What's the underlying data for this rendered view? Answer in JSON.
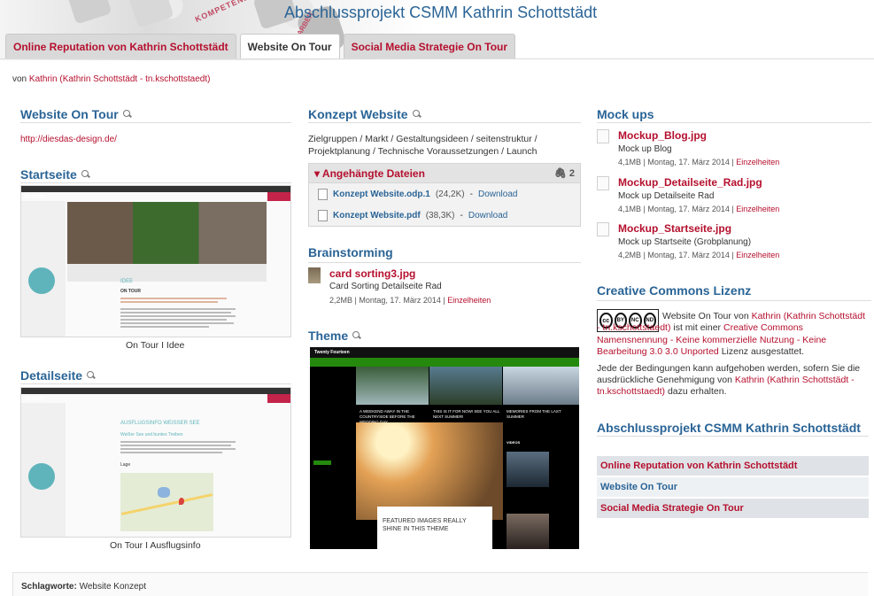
{
  "header": {
    "site_title": "Abschlussprojekt CSMM Kathrin Schottstädt",
    "logo_word_1": "KOMPETENZ",
    "logo_word_2": "ARBEIT",
    "tabs": [
      {
        "label": "Online Reputation von Kathrin Schottstädt",
        "active": false
      },
      {
        "label": "Website On Tour",
        "active": true
      },
      {
        "label": "Social Media Strategie On Tour",
        "active": false
      }
    ]
  },
  "byline": {
    "prefix": "von",
    "author": "Kathrin (Kathrin Schottstädt - tn.kschottstaedt)"
  },
  "col1": {
    "website_title": "Website On Tour",
    "website_link": "http://diesdas-design.de/",
    "start_title": "Startseite",
    "start_caption": "On Tour I Idee",
    "start_shot": {
      "site_name": "ON TOUR",
      "heading": "IDEE",
      "subheading": "ON TOUR"
    },
    "detail_title": "Detailseite",
    "detail_caption": "On Tour I Ausflugsinfo",
    "detail_shot": {
      "site_name": "ON TOUR",
      "heading": "AUSFLUGSINFO WEISSER SEE",
      "subheading": "Weißer See und buntes Treiben",
      "map_label": "Lage"
    }
  },
  "col2": {
    "concept_title": "Konzept Website",
    "concept_text": "Zielgruppen / Markt / Gestaltungsideen / seitenstruktur / Projektplanung / Technische Voraussetzungen / Launch",
    "attachments_label": "Angehängte Dateien",
    "attachments_count": "2",
    "files": [
      {
        "name": "Konzept Website.odp.1",
        "size": "(24,2K)",
        "sep": "-",
        "download": "Download"
      },
      {
        "name": "Konzept Website.pdf",
        "size": "(38,3K)",
        "sep": "-",
        "download": "Download"
      }
    ],
    "brainstorm_title": "Brainstorming",
    "brainstorm_file": "card sorting3.jpg",
    "brainstorm_desc": "Card Sorting Detailseite Rad",
    "brainstorm_meta": "2,2MB | Montag, 17. März 2014 |",
    "brainstorm_details": "Einzelheiten",
    "theme_title": "Theme",
    "theme_shot": {
      "site_name": "Twenty Fourteen",
      "feature_text": "FEATURED IMAGES REALLY SHINE IN THIS THEME",
      "videos_label": "VIDEOS",
      "tiles": [
        "A WEEKEND AWAY IN THE COUNTRYSIDE BEFORE THE WEDDING DAY",
        "THIS IS IT FOR NOW! SEE YOU ALL NEXT SUMMER!",
        "MEMORIES FROM THE LAST SUMMER"
      ]
    }
  },
  "col3": {
    "mockups_title": "Mock ups",
    "mockups": [
      {
        "name": "Mockup_Blog.jpg",
        "desc": "Mock up Blog",
        "meta": "4,1MB | Montag, 17. März 2014 |",
        "details": "Einzelheiten"
      },
      {
        "name": "Mockup_Detailseite_Rad.jpg",
        "desc": "Mock up Detailseite Rad",
        "meta": "4,1MB | Montag, 17. März 2014 |",
        "details": "Einzelheiten"
      },
      {
        "name": "Mockup_Startseite.jpg",
        "desc": "Mock up Startseite (Grobplanung)",
        "meta": "4,2MB | Montag, 17. März 2014 |",
        "details": "Einzelheiten"
      }
    ],
    "cc_title": "Creative Commons Lizenz",
    "cc_badge": [
      "cc",
      "BY",
      "NC",
      "ND"
    ],
    "cc_text_1": "Website On Tour von",
    "cc_author": "Kathrin (Kathrin Schottstädt - tn.kschottstaedt)",
    "cc_text_2": "ist mit einer",
    "cc_license": "Creative Commons Namensnennung - Keine kommerzielle Nutzung - Keine Bearbeitung 3.0 3.0 Unported",
    "cc_text_3": "Lizenz ausgestattet.",
    "cc_cond_1": "Jede der Bedingungen kann aufgehoben werden, sofern Sie die ausdrückliche Genehmigung von",
    "cc_cond_author": "Kathrin (Kathrin Schottstädt - tn.kschottstaedt)",
    "cc_cond_2": "dazu erhalten.",
    "nav_title": "Abschlussprojekt CSMM Kathrin Schottstädt",
    "nav_items": [
      {
        "label": "Online Reputation von Kathrin Schottstädt",
        "active": false
      },
      {
        "label": "Website On Tour",
        "active": true
      },
      {
        "label": "Social Media Strategie On Tour",
        "active": false
      }
    ]
  },
  "tags": {
    "label": "Schlagworte:",
    "value": "Website Konzept"
  }
}
